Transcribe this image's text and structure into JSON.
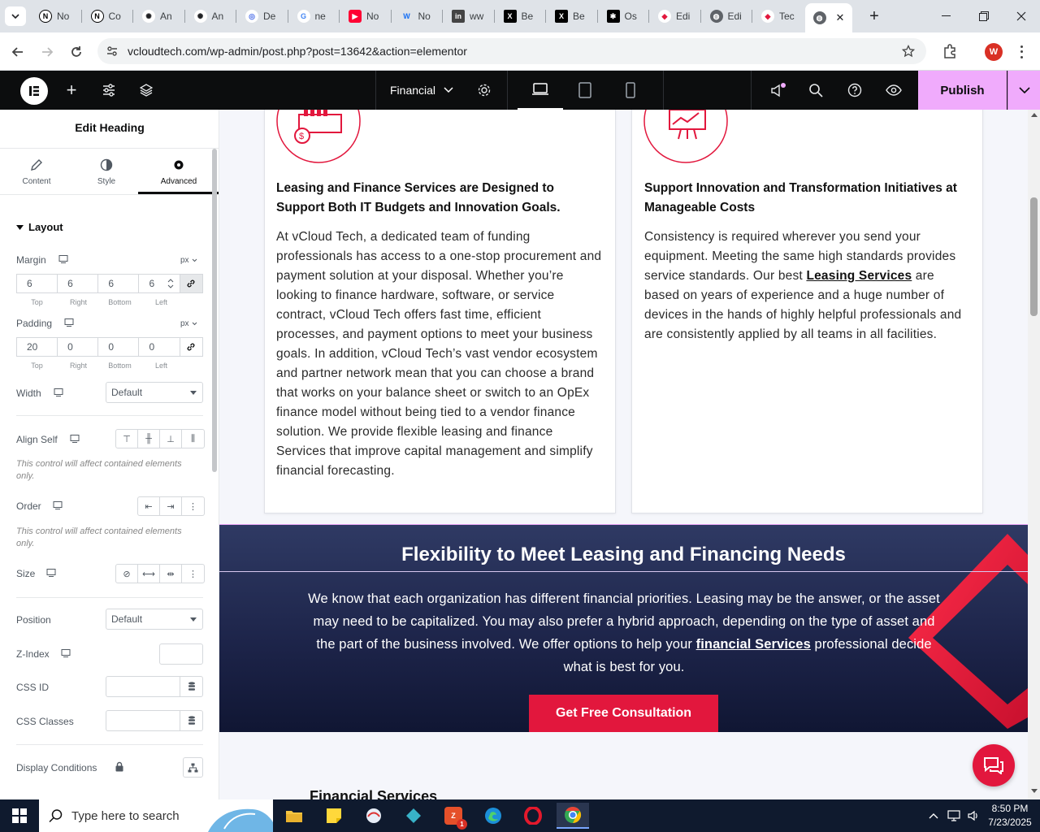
{
  "browser": {
    "tabs": [
      {
        "label": "No",
        "icon": "notion-icon"
      },
      {
        "label": "Co",
        "icon": "notion-icon"
      },
      {
        "label": "An",
        "icon": "openai-icon"
      },
      {
        "label": "An",
        "icon": "openai-icon"
      },
      {
        "label": "De",
        "icon": "deepl-icon"
      },
      {
        "label": "ne",
        "icon": "google-icon"
      },
      {
        "label": "No",
        "icon": "youtube-icon"
      },
      {
        "label": "No",
        "icon": "webflow-icon"
      },
      {
        "label": "ww",
        "icon": "linkedin-icon"
      },
      {
        "label": "Be",
        "icon": "x-icon"
      },
      {
        "label": "Be",
        "icon": "x-icon"
      },
      {
        "label": "Os",
        "icon": "app-icon"
      },
      {
        "label": "Edi",
        "icon": "elementor-icon"
      },
      {
        "label": "Edi",
        "icon": "globe-icon"
      },
      {
        "label": "Tec",
        "icon": "elementor-icon"
      },
      {
        "label": "",
        "icon": "globe-icon"
      }
    ],
    "url": "vcloudtech.com/wp-admin/post.php?post=13642&action=elementor",
    "profile_initial": "W"
  },
  "editor": {
    "page_selector": "Financial",
    "publish_label": "Publish"
  },
  "panel": {
    "title": "Edit Heading",
    "tabs": [
      "Content",
      "Style",
      "Advanced"
    ],
    "section": "Layout",
    "margin": {
      "label": "Margin",
      "unit": "px",
      "values": [
        "6",
        "6",
        "6",
        "6"
      ]
    },
    "padding": {
      "label": "Padding",
      "unit": "px",
      "values": [
        "20",
        "0",
        "0",
        "0"
      ]
    },
    "dim_labels": [
      "Top",
      "Right",
      "Bottom",
      "Left"
    ],
    "width": {
      "label": "Width",
      "value": "Default"
    },
    "align_self": {
      "label": "Align Self"
    },
    "note": "This control will affect contained elements only.",
    "order": {
      "label": "Order"
    },
    "size": {
      "label": "Size"
    },
    "position": {
      "label": "Position",
      "value": "Default"
    },
    "zindex": {
      "label": "Z-Index"
    },
    "css_id": {
      "label": "CSS ID"
    },
    "css_classes": {
      "label": "CSS Classes"
    },
    "display_conditions": {
      "label": "Display Conditions"
    }
  },
  "canvas": {
    "card1": {
      "heading": "Leasing and Finance Services are Designed to Support Both IT Budgets and Innovation Goals.",
      "body": "At vCloud Tech, a dedicated team of funding professionals has access to a one-stop procurement and payment solution at your disposal. Whether you’re looking to finance hardware, software, or service contract, vCloud Tech offers fast time, efficient processes, and payment options to meet your business goals. In addition, vCloud Tech’s vast vendor ecosystem and partner network mean that you can choose a brand that works on your balance sheet or switch to an OpEx finance model without being tied to a vendor finance solution. We provide flexible leasing and finance Services that improve capital management and simplify financial forecasting."
    },
    "card2": {
      "heading": "Support Innovation and Transformation Initiatives at Manageable Costs",
      "body_a": "Consistency is required wherever you send your equipment. Meeting the same high standards provides service standards. Our best ",
      "link": "Leasing Services",
      "body_b": " are based on years of experience and a huge number of devices in the hands of highly helpful professionals and are consistently applied by all teams in all facilities."
    },
    "band": {
      "heading": "Flexibility to Meet Leasing and Financing Needs",
      "body_a": "We know that each organization has different financial priorities. Leasing may be the answer, or the asset may need to be capitalized. You may also prefer a hybrid approach, depending on the type of asset and the part of the business involved. We offer options to help your ",
      "link": "financial Services",
      "body_b": " professional decide what is best for you.",
      "cta": "Get Free Consultation"
    },
    "next_heading": "Financial Services"
  },
  "taskbar": {
    "search_placeholder": "Type here to search",
    "time": "8:50 PM",
    "date": "7/23/2025",
    "badge": "1"
  },
  "colors": {
    "accent_red": "#e2173d",
    "elementor_publish": "#f0abfc",
    "band_dark": "#1c2348"
  }
}
